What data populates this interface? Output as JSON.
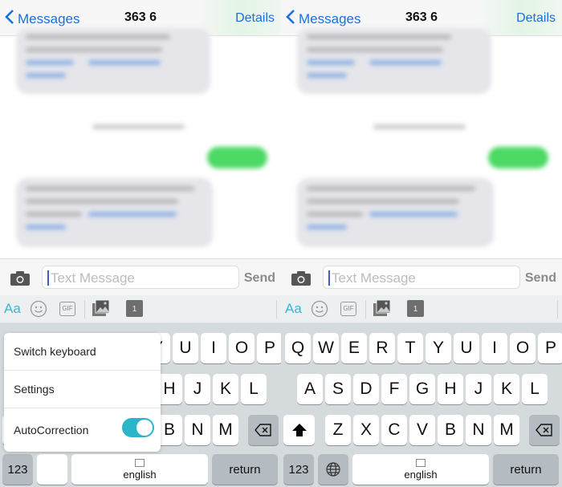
{
  "panels": [
    {
      "id": "left",
      "show_popup": true,
      "globe_key": false
    },
    {
      "id": "right",
      "show_popup": false,
      "globe_key": true
    }
  ],
  "nav": {
    "back_label": "Messages",
    "title": "363 6",
    "details_label": "Details"
  },
  "input": {
    "placeholder": "Text Message",
    "send_label": "Send"
  },
  "toolbar": {
    "font_label": "Aa",
    "gif_label": "GIF",
    "calendar_day": "1"
  },
  "keyboard": {
    "row1": [
      "Q",
      "W",
      "E",
      "R",
      "T",
      "Y",
      "U",
      "I",
      "O",
      "P"
    ],
    "row2": [
      "A",
      "S",
      "D",
      "F",
      "G",
      "H",
      "J",
      "K",
      "L"
    ],
    "row3": [
      "Z",
      "X",
      "C",
      "V",
      "B",
      "N",
      "M"
    ],
    "numbers_label": "123",
    "space_label": "english",
    "return_label": "return"
  },
  "popup": {
    "items": [
      "Switch keyboard",
      "Settings",
      "AutoCorrection"
    ],
    "autocorrection_on": true
  },
  "colors": {
    "accent": "#1a6fe0",
    "toggle": "#2bb5c8",
    "bubble_sent": "#4cd964",
    "bubble_received": "#e5e5ea"
  }
}
